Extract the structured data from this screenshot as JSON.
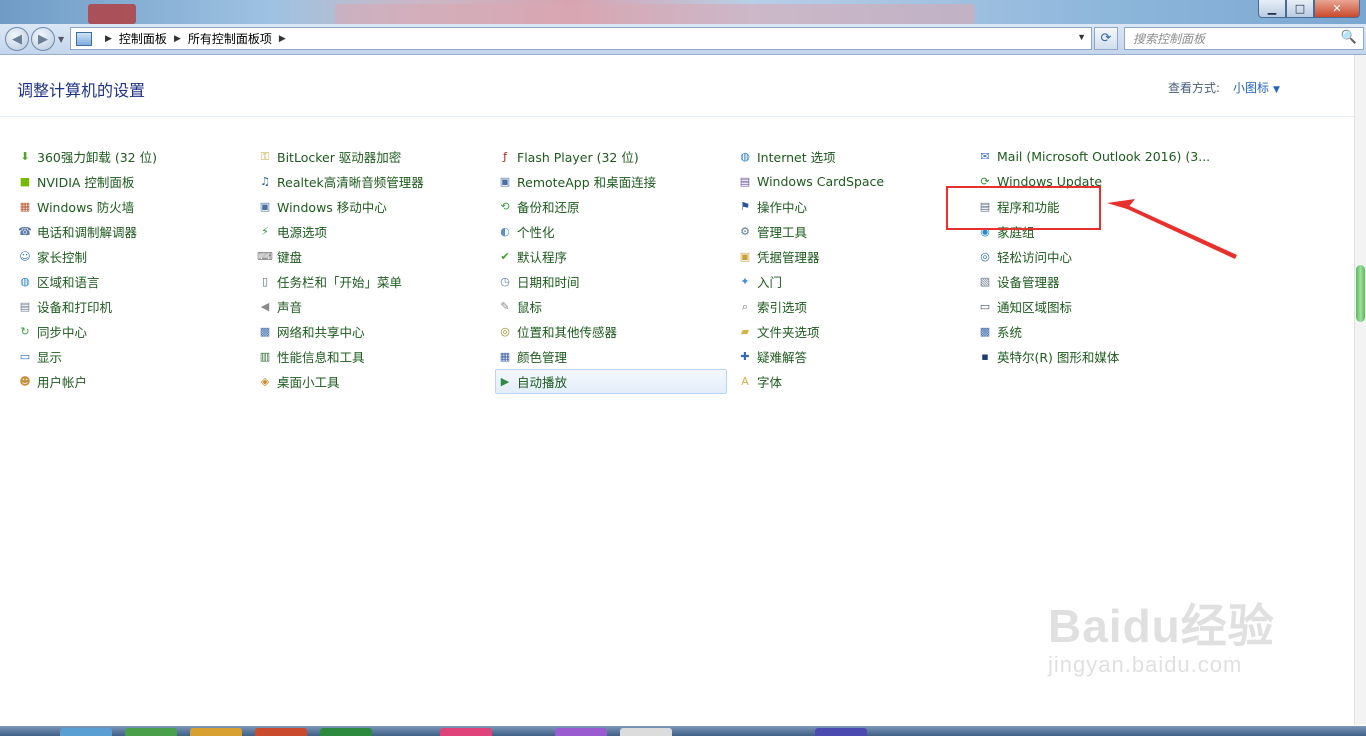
{
  "window": {
    "minimize": "▁",
    "maximize": "□",
    "close": "✕"
  },
  "nav": {
    "back_icon": "◀",
    "forward_icon": "▶",
    "breadcrumb": [
      "控制面板",
      "所有控制面板项"
    ],
    "refresh_icon": "⟳",
    "search_placeholder": "搜索控制面板"
  },
  "header": {
    "title": "调整计算机的设置",
    "view_by_label": "查看方式:",
    "view_by_value": "小图标"
  },
  "columns": [
    [
      {
        "label": "360强力卸载 (32 位)",
        "icon": "uninstall-icon",
        "color": "#5aa02c"
      },
      {
        "label": "NVIDIA 控制面板",
        "icon": "nvidia-icon",
        "color": "#76b900"
      },
      {
        "label": "Windows 防火墙",
        "icon": "firewall-icon",
        "color": "#b5512d"
      },
      {
        "label": "电话和调制解调器",
        "icon": "phone-modem-icon",
        "color": "#5a7aa6"
      },
      {
        "label": "家长控制",
        "icon": "parental-control-icon",
        "color": "#3e7cc4"
      },
      {
        "label": "区域和语言",
        "icon": "globe-icon",
        "color": "#2f8bc9"
      },
      {
        "label": "设备和打印机",
        "icon": "printer-icon",
        "color": "#6b7a8c"
      },
      {
        "label": "同步中心",
        "icon": "sync-icon",
        "color": "#3aa53a"
      },
      {
        "label": "显示",
        "icon": "display-icon",
        "color": "#2a6cc0"
      },
      {
        "label": "用户帐户",
        "icon": "users-icon",
        "color": "#c7903c"
      }
    ],
    [
      {
        "label": "BitLocker 驱动器加密",
        "icon": "bitlocker-icon",
        "color": "#c9a23a"
      },
      {
        "label": "Realtek高清晰音频管理器",
        "icon": "audio-manager-icon",
        "color": "#2c5aa0"
      },
      {
        "label": "Windows 移动中心",
        "icon": "mobility-icon",
        "color": "#4a6fa5"
      },
      {
        "label": "电源选项",
        "icon": "power-icon",
        "color": "#3c8a3c"
      },
      {
        "label": "键盘",
        "icon": "keyboard-icon",
        "color": "#777777"
      },
      {
        "label": "任务栏和「开始」菜单",
        "icon": "taskbar-icon",
        "color": "#5d6f86"
      },
      {
        "label": "声音",
        "icon": "speaker-icon",
        "color": "#8a8a8a"
      },
      {
        "label": "网络和共享中心",
        "icon": "network-icon",
        "color": "#3f6fa8"
      },
      {
        "label": "性能信息和工具",
        "icon": "performance-icon",
        "color": "#2d6b3a"
      },
      {
        "label": "桌面小工具",
        "icon": "gadgets-icon",
        "color": "#d08a2a"
      }
    ],
    [
      {
        "label": "Flash Player (32 位)",
        "icon": "flash-icon",
        "color": "#9c1e1e"
      },
      {
        "label": "RemoteApp 和桌面连接",
        "icon": "remoteapp-icon",
        "color": "#4a6fa5"
      },
      {
        "label": "备份和还原",
        "icon": "backup-icon",
        "color": "#3e9a3e"
      },
      {
        "label": "个性化",
        "icon": "personalize-icon",
        "color": "#5a8fd0"
      },
      {
        "label": "默认程序",
        "icon": "default-programs-icon",
        "color": "#4a9a2a"
      },
      {
        "label": "日期和时间",
        "icon": "clock-icon",
        "color": "#6a7f9a"
      },
      {
        "label": "鼠标",
        "icon": "mouse-icon",
        "color": "#888888"
      },
      {
        "label": "位置和其他传感器",
        "icon": "sensor-icon",
        "color": "#9a8a2a"
      },
      {
        "label": "颜色管理",
        "icon": "color-management-icon",
        "color": "#3a5fa8"
      },
      {
        "label": "自动播放",
        "icon": "autoplay-icon",
        "color": "#2d8a3e"
      }
    ],
    [
      {
        "label": "Internet 选项",
        "icon": "internet-options-icon",
        "color": "#2f7fc9"
      },
      {
        "label": "Windows CardSpace",
        "icon": "cardspace-icon",
        "color": "#6a4fa5"
      },
      {
        "label": "操作中心",
        "icon": "flag-icon",
        "color": "#2a4fa0"
      },
      {
        "label": "管理工具",
        "icon": "admin-tools-icon",
        "color": "#5d7a9c"
      },
      {
        "label": "凭据管理器",
        "icon": "credential-icon",
        "color": "#c9a23a"
      },
      {
        "label": "入门",
        "icon": "getting-started-icon",
        "color": "#4a8fd0"
      },
      {
        "label": "索引选项",
        "icon": "indexing-icon",
        "color": "#6a7a8a"
      },
      {
        "label": "文件夹选项",
        "icon": "folder-options-icon",
        "color": "#d6b24a"
      },
      {
        "label": "疑难解答",
        "icon": "troubleshoot-icon",
        "color": "#3a6aa8"
      },
      {
        "label": "字体",
        "icon": "font-folder-icon",
        "color": "#d6b24a"
      }
    ],
    [
      {
        "label": "Mail (Microsoft Outlook 2016) (3...",
        "icon": "mail-icon",
        "color": "#3a70b8"
      },
      {
        "label": "Windows Update",
        "icon": "windows-update-icon",
        "color": "#3a8a3a"
      },
      {
        "label": "程序和功能",
        "icon": "programs-features-icon",
        "color": "#5a6a7c"
      },
      {
        "label": "家庭组",
        "icon": "homegroup-icon",
        "color": "#2f8bc9"
      },
      {
        "label": "轻松访问中心",
        "icon": "ease-of-access-icon",
        "color": "#2a6cc0"
      },
      {
        "label": "设备管理器",
        "icon": "device-manager-icon",
        "color": "#6a7a8a"
      },
      {
        "label": "通知区域图标",
        "icon": "notification-icon",
        "color": "#4a5a6c"
      },
      {
        "label": "系统",
        "icon": "system-icon",
        "color": "#3a6aa8"
      },
      {
        "label": "英特尔(R) 图形和媒体",
        "icon": "intel-graphics-icon",
        "color": "#1e3a6e"
      }
    ]
  ],
  "watermark": {
    "main": "Baidu经验",
    "sub": "jingyan.baidu.com"
  }
}
